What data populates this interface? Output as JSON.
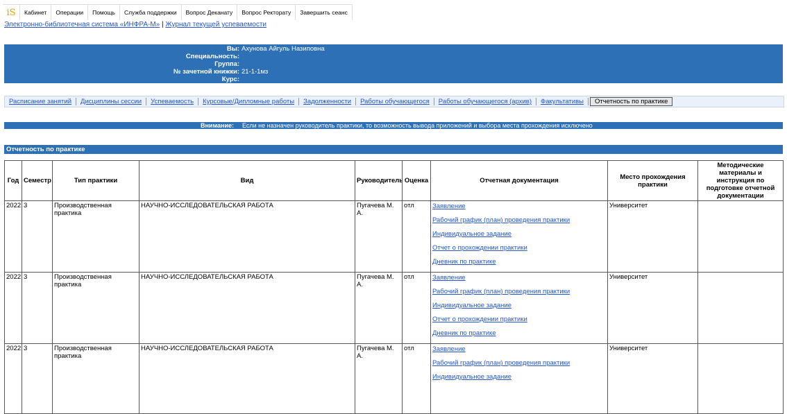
{
  "top_menu": {
    "logo": "iS",
    "items": [
      "Кабинет",
      "Операции",
      "Помощь",
      "Служба поддержки",
      "Вопрос Деканату",
      "Вопрос Ректорату",
      "Завершить сеанс"
    ]
  },
  "links": {
    "library": "Электронно-библиотечная система «ИНФРА-М»",
    "separator": "|",
    "journal": "Журнал текущей успеваемости"
  },
  "student": {
    "you_label": "Вы:",
    "you_value": "Ахунова Айгуль Назиповна",
    "specialty_label": "Специальность:",
    "specialty_value": "",
    "group_label": "Группа:",
    "group_value": "",
    "record_label": "№ зачетной книжки:",
    "record_value": "21-1-1мз",
    "course_label": "Курс:",
    "course_value": ""
  },
  "tabs": [
    "Расписание занятий",
    "Дисциплины сессии",
    "Успеваемость",
    "Курсовые/Дипломные работы",
    "Задолженности",
    "Работы обучающегося",
    "Работы обучающегося (архив)",
    "Факультативы",
    "Отчетность по практике"
  ],
  "attention": {
    "label": "Внимание:",
    "text": "Если не назначен руководитель практики, то возможность вывода приложений и выбора места прохождения исключено"
  },
  "section_title": "Отчетность по практике",
  "table": {
    "headers": {
      "year": "Год",
      "semester": "Семестр",
      "type": "Тип практики",
      "kind": "Вид",
      "supervisor": "Руководитель",
      "grade": "Оценка",
      "docs": "Отчетная документация",
      "place": "Место прохождения практики",
      "materials": "Методические материалы и инструкция по подготовке отчетной документации"
    },
    "rows": [
      {
        "year": "2022",
        "semester": "3",
        "type": "Производственная практика",
        "kind": "НАУЧНО-ИССЛЕДОВАТЕЛЬСКАЯ РАБОТА",
        "supervisor": "Пугачева М. А.",
        "grade": "отл",
        "docs": [
          "Заявление",
          "Рабочий график (план) проведения практики",
          "Индивидуальное задание",
          "Отчет о прохождении практики",
          "Дневник по практике"
        ],
        "place": "Университет",
        "materials": ""
      },
      {
        "year": "2022",
        "semester": "3",
        "type": "Производственная практика",
        "kind": "НАУЧНО-ИССЛЕДОВАТЕЛЬСКАЯ РАБОТА",
        "supervisor": "Пугачева М. А.",
        "grade": "отл",
        "docs": [
          "Заявление",
          "Рабочий график (план) проведения практики",
          "Индивидуальное задание",
          "Отчет о прохождении практики",
          "Дневник по практике"
        ],
        "place": "Университет",
        "materials": ""
      },
      {
        "year": "2022",
        "semester": "3",
        "type": "Производственная практика",
        "kind": "НАУЧНО-ИССЛЕДОВАТЕЛЬСКАЯ РАБОТА",
        "supervisor": "Пугачева М. А.",
        "grade": "отл",
        "docs": [
          "Заявление",
          "Рабочий график (план) проведения практики",
          "Индивидуальное задание"
        ],
        "place": "Университет",
        "materials": ""
      }
    ]
  },
  "colors": {
    "header_blue": "#2e70b5",
    "link_blue": "#2255cc",
    "logo_gold": "#e2a100"
  }
}
